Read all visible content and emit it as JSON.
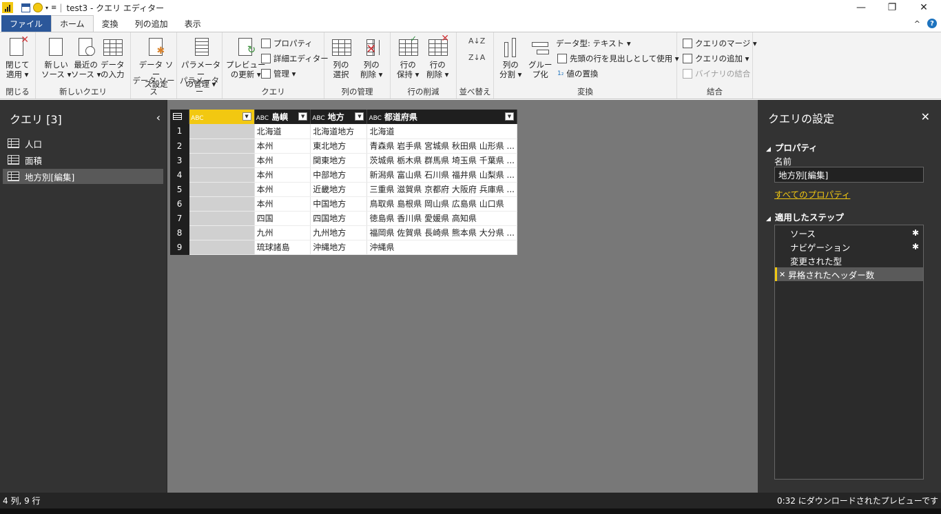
{
  "window": {
    "title": "test3 - クエリ エディター",
    "minimize": "—",
    "restore": "❐",
    "close": "✕"
  },
  "tabs": [
    "ファイル",
    "ホーム",
    "変換",
    "列の追加",
    "表示"
  ],
  "tabs_right": {
    "collapse": "^",
    "help": "?"
  },
  "ribbon": {
    "groups": [
      "閉じる",
      "新しいクエリ",
      "データ ソース",
      "パラメーター",
      "クエリ",
      "列の管理",
      "行の削減",
      "並べ替え",
      "変換",
      "結合"
    ],
    "close_apply": [
      "閉じて",
      "適用 ▾"
    ],
    "new_source": [
      "新しい",
      "ソース ▾"
    ],
    "recent_source": [
      "最近の",
      "ソース ▾"
    ],
    "enter_data": [
      "データ",
      "の入力"
    ],
    "datasource_settings": [
      "データ ソー",
      "ス設定"
    ],
    "manage_params": [
      "パラメーター",
      "の管理 ▾"
    ],
    "refresh_preview": [
      "プレビュー",
      "の更新 ▾"
    ],
    "properties": "プロパティ",
    "advanced_editor": "詳細エディター",
    "manage": "管理 ▾",
    "choose_columns": [
      "列の",
      "選択"
    ],
    "remove_columns": [
      "列の",
      "削除 ▾"
    ],
    "keep_rows": [
      "行の",
      "保持 ▾"
    ],
    "remove_rows": [
      "行の",
      "削除 ▾"
    ],
    "sort_az": "A↓Z",
    "sort_za": "Z↓A",
    "split_column": [
      "列の",
      "分割 ▾"
    ],
    "group_by": [
      "グルー",
      "プ化"
    ],
    "data_type": "データ型: テキスト ▾",
    "use_first_row": "先頭の行を見出しとして使用 ▾",
    "replace_values": "値の置換",
    "merge_queries": "クエリのマージ ▾",
    "append_queries": "クエリの追加 ▾",
    "combine_binaries": "バイナリの結合"
  },
  "left_pane": {
    "title": "クエリ [3]",
    "collapse": "‹",
    "queries": [
      "人口",
      "面積",
      "地方別[編集]"
    ]
  },
  "grid": {
    "type_glyph": "ABC",
    "dropdown": "▼",
    "headers": [
      "",
      "島嶼",
      "地方",
      "都道府県"
    ],
    "rows": [
      [
        "1",
        "",
        "北海道",
        "北海道地方",
        "北海道"
      ],
      [
        "2",
        "",
        "本州",
        "東北地方",
        "青森県 岩手県 宮城県 秋田県 山形県 ..."
      ],
      [
        "3",
        "",
        "本州",
        "関東地方",
        "茨城県 栃木県 群馬県 埼玉県 千葉県 ..."
      ],
      [
        "4",
        "",
        "本州",
        "中部地方",
        "新潟県 富山県 石川県 福井県 山梨県 ..."
      ],
      [
        "5",
        "",
        "本州",
        "近畿地方",
        "三重県 滋賀県 京都府 大阪府 兵庫県 ..."
      ],
      [
        "6",
        "",
        "本州",
        "中国地方",
        "鳥取県 島根県 岡山県 広島県 山口県"
      ],
      [
        "7",
        "",
        "四国",
        "四国地方",
        "徳島県 香川県 愛媛県 高知県"
      ],
      [
        "8",
        "",
        "九州",
        "九州地方",
        "福岡県 佐賀県 長崎県 熊本県 大分県 ..."
      ],
      [
        "9",
        "",
        "琉球諸島",
        "沖縄地方",
        "沖縄県"
      ]
    ]
  },
  "right_pane": {
    "title": "クエリの設定",
    "close": "✕",
    "properties_header": "プロパティ",
    "name_label": "名前",
    "name_value": "地方別[編集]",
    "all_properties": "すべてのプロパティ",
    "steps_header": "適用したステップ",
    "steps": [
      "ソース",
      "ナビゲーション",
      "変更された型",
      "昇格されたヘッダー数"
    ],
    "gear": "✱",
    "delete_step": "✕"
  },
  "status": {
    "left": "4 列, 9 行",
    "right": "0:32 にダウンロードされたプレビューです"
  }
}
